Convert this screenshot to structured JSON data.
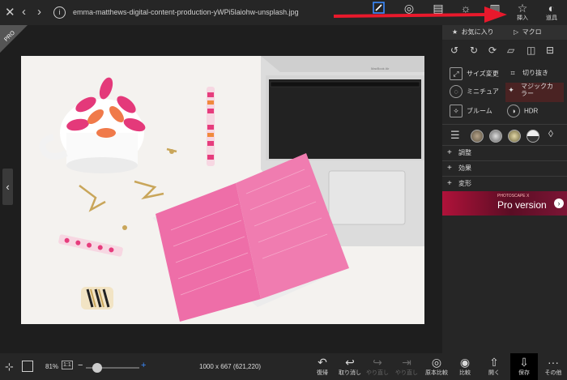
{
  "window": {
    "filename": "emma-matthews-digital-content-production-yWPi5laiohw-unsplash.jpg"
  },
  "top_tools": [
    {
      "label": ""
    },
    {
      "label": ""
    },
    {
      "label": ""
    },
    {
      "label": ""
    },
    {
      "label": ""
    },
    {
      "label": "挿入"
    },
    {
      "label": "道具"
    }
  ],
  "panel": {
    "tab_favorites": "お気に入り",
    "tab_macro": "マクロ",
    "effects": [
      "サイズ変更",
      "切り抜き",
      "ミニチュア",
      "マジックカラー",
      "ブルーム",
      "HDR"
    ],
    "sections": [
      "調整",
      "効果",
      "変形"
    ],
    "promo_brand": "PHOTOSCAPE X",
    "promo_text": "Pro version"
  },
  "badge": {
    "pro": "PRO"
  },
  "image": {
    "laptop_label": "MacBook Air"
  },
  "bottom": {
    "zoom_percent": "81%",
    "zoom_ratio": "1:1",
    "dimensions": "1000 x 667 (621,220)",
    "buttons": [
      "復帰",
      "取り消し",
      "やり直し",
      "やり直し",
      "原本比較",
      "比較",
      "開く",
      "保存",
      "その他"
    ]
  },
  "colors": {
    "accent_red": "#e8192c",
    "highlight": "#4a2323",
    "panel_bg": "#262626"
  }
}
